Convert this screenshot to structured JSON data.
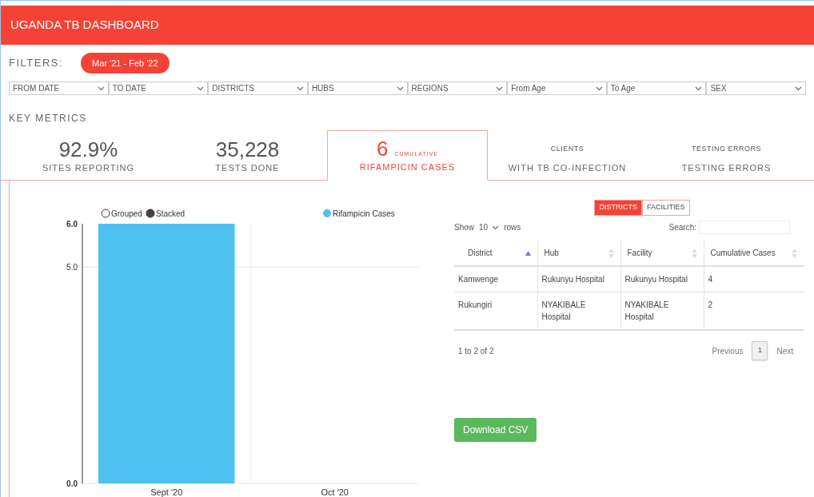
{
  "header": {
    "title": "UGANDA TB DASHBOARD"
  },
  "filters": {
    "label": "FILTERS:",
    "period": "Mar '21 - Feb '22",
    "dropdowns": [
      {
        "label": "FROM DATE"
      },
      {
        "label": "TO DATE"
      },
      {
        "label": "DISTRICTS"
      },
      {
        "label": "HUBS"
      },
      {
        "label": "REGIONS"
      },
      {
        "label": "From Age"
      },
      {
        "label": "To Age"
      },
      {
        "label": "SEX"
      }
    ]
  },
  "key_metrics": {
    "title": "KEY METRICS",
    "tabs": [
      {
        "value": "92.9%",
        "label": "SITES REPORTING",
        "selected": false
      },
      {
        "value": "35,228",
        "label": "TESTS DONE",
        "selected": false
      },
      {
        "value": "6",
        "note": "CUMULATIVE",
        "label": "RIFAMPICIN CASES",
        "selected": true
      },
      {
        "note": "CLIENTS",
        "label": "WITH TB CO-INFECTION",
        "selected": false
      },
      {
        "note": "TESTING ERRORS",
        "label": "TESTING ERRORS",
        "selected": false
      }
    ]
  },
  "chart": {
    "modes": [
      {
        "label": "Grouped",
        "selected": false
      },
      {
        "label": "Stacked",
        "selected": true
      }
    ],
    "chart_data": {
      "type": "bar",
      "categories": [
        "Sept '20",
        "Oct '20"
      ],
      "series": [
        {
          "name": "Rifampicin Cases",
          "color": "#4fc1f0",
          "values": [
            6,
            null
          ]
        }
      ],
      "ylim": [
        0,
        6
      ],
      "yticks": [
        {
          "value": 0,
          "label": "0.0"
        },
        {
          "value": 5,
          "label": "5.0"
        },
        {
          "value": 6,
          "label": "6.0"
        }
      ]
    }
  },
  "table_view": {
    "toggles": [
      {
        "label": "DISTRICTS",
        "selected": true
      },
      {
        "label": "FACILITIES",
        "selected": false
      }
    ],
    "show_label": "Show",
    "page_size": "10",
    "rows_label": "rows",
    "search_label": "Search:",
    "columns": [
      {
        "label": "District",
        "sorted": true
      },
      {
        "label": "Hub",
        "sorted": false
      },
      {
        "label": "Facility",
        "sorted": false
      },
      {
        "label": "Cumulative Cases",
        "sorted": false
      }
    ],
    "rows": [
      [
        "Kamwenge",
        "Rukunyu Hospital",
        "Rukunyu Hospital",
        "4"
      ],
      [
        "Rukungiri",
        "NYAKIBALE Hospital",
        "NYAKIBALE Hospital",
        "2"
      ]
    ],
    "info": "1 to 2 of 2",
    "previous": "Previous",
    "pages": [
      {
        "label": "1",
        "selected": true
      }
    ],
    "next": "Next",
    "download": "Download CSV"
  }
}
